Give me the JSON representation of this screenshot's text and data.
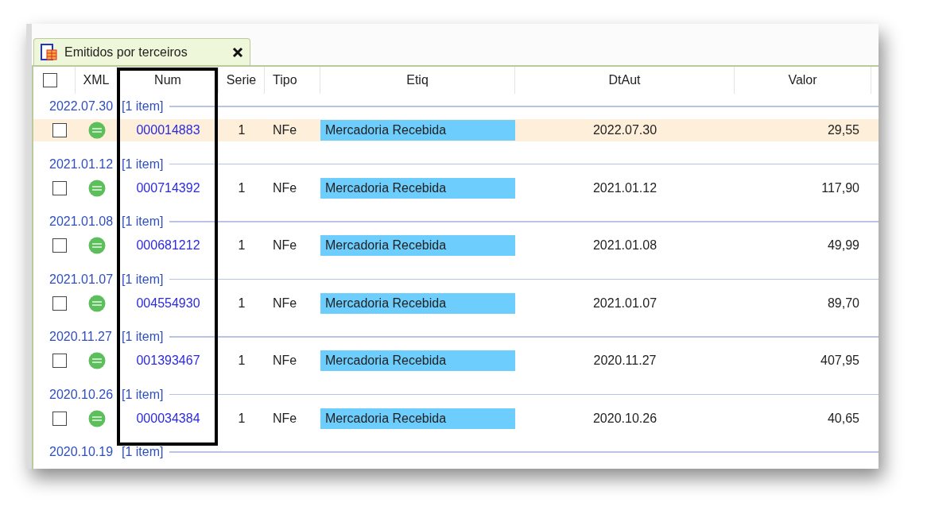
{
  "tab": {
    "title": "Emitidos por terceiros",
    "selected": true
  },
  "header": {
    "checked": false,
    "columns": [
      "XML",
      "Num",
      "Serie",
      "Tipo",
      "Etiq",
      "DtAut",
      "Valor"
    ]
  },
  "groups": [
    {
      "date": "2022.07.30",
      "count": "[1 item]",
      "rows": [
        {
          "selected": true,
          "checked": false,
          "num": "000014883",
          "serie": "1",
          "tipo": "NFe",
          "etiq": "Mercadoria Recebida",
          "dtaut": "2022.07.30",
          "valor": "29,55"
        }
      ]
    },
    {
      "date": "2021.01.12",
      "count": "[1 item]",
      "rows": [
        {
          "selected": false,
          "checked": false,
          "num": "000714392",
          "serie": "1",
          "tipo": "NFe",
          "etiq": "Mercadoria Recebida",
          "dtaut": "2021.01.12",
          "valor": "117,90"
        }
      ]
    },
    {
      "date": "2021.01.08",
      "count": "[1 item]",
      "rows": [
        {
          "selected": false,
          "checked": false,
          "num": "000681212",
          "serie": "1",
          "tipo": "NFe",
          "etiq": "Mercadoria Recebida",
          "dtaut": "2021.01.08",
          "valor": "49,99"
        }
      ]
    },
    {
      "date": "2021.01.07",
      "count": "[1 item]",
      "rows": [
        {
          "selected": false,
          "checked": false,
          "num": "004554930",
          "serie": "1",
          "tipo": "NFe",
          "etiq": "Mercadoria Recebida",
          "dtaut": "2021.01.07",
          "valor": "89,70"
        }
      ]
    },
    {
      "date": "2020.11.27",
      "count": "[1 item]",
      "rows": [
        {
          "selected": false,
          "checked": false,
          "num": "001393467",
          "serie": "1",
          "tipo": "NFe",
          "etiq": "Mercadoria Recebida",
          "dtaut": "2020.11.27",
          "valor": "407,95"
        }
      ]
    },
    {
      "date": "2020.10.26",
      "count": "[1 item]",
      "rows": [
        {
          "selected": false,
          "checked": false,
          "num": "000034384",
          "serie": "1",
          "tipo": "NFe",
          "etiq": "Mercadoria Recebida",
          "dtaut": "2020.10.26",
          "valor": "40,65"
        }
      ]
    },
    {
      "date": "2020.10.19",
      "count": "[1 item]"
    }
  ]
}
